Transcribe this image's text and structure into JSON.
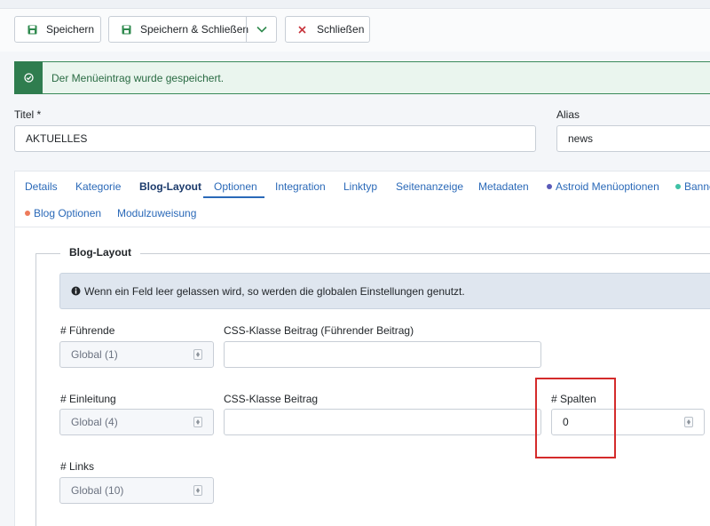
{
  "toolbar": {
    "save_label": "Speichern",
    "save_close_label": "Speichern & Schließen",
    "close_label": "Schließen"
  },
  "alert": {
    "message": "Der Menüeintrag wurde gespeichert."
  },
  "title_field": {
    "label": "Titel *",
    "value": "AKTUELLES"
  },
  "alias_field": {
    "label": "Alias",
    "value": "news"
  },
  "tabs": [
    {
      "label": "Details"
    },
    {
      "label": "Kategorie"
    },
    {
      "label": "Blog-Layout"
    },
    {
      "label": "Optionen"
    },
    {
      "label": "Integration"
    },
    {
      "label": "Linktyp"
    },
    {
      "label": "Seitenanzeige"
    },
    {
      "label": "Metadaten"
    },
    {
      "label": "Astroid Menüoptionen"
    },
    {
      "label": "Banne"
    },
    {
      "label": "Blog Optionen"
    },
    {
      "label": "Modulzuweisung"
    }
  ],
  "fieldset": {
    "legend": "Blog-Layout"
  },
  "info": {
    "message": "Wenn ein Feld leer gelassen wird, so werden die globalen Einstellungen genutzt."
  },
  "fields": {
    "leading": {
      "label": "# Führende",
      "value": "Global (1)"
    },
    "leading_css": {
      "label": "CSS-Klasse Beitrag (Führender Beitrag)",
      "value": ""
    },
    "intro": {
      "label": "# Einleitung",
      "value": "Global (4)"
    },
    "intro_css": {
      "label": "CSS-Klasse Beitrag",
      "value": ""
    },
    "columns": {
      "label": "# Spalten",
      "value": "0"
    },
    "links": {
      "label": "# Links",
      "value": "Global (10)"
    }
  },
  "colors": {
    "save_green": "#2f8a4e",
    "close_red": "#c7333b",
    "link_blue": "#2a69b8",
    "highlight_red": "#d42b2b",
    "astroid_dot": "#5a5ab8",
    "banner_dot": "#3fc1a5",
    "blog_dot": "#ee7b5b"
  }
}
